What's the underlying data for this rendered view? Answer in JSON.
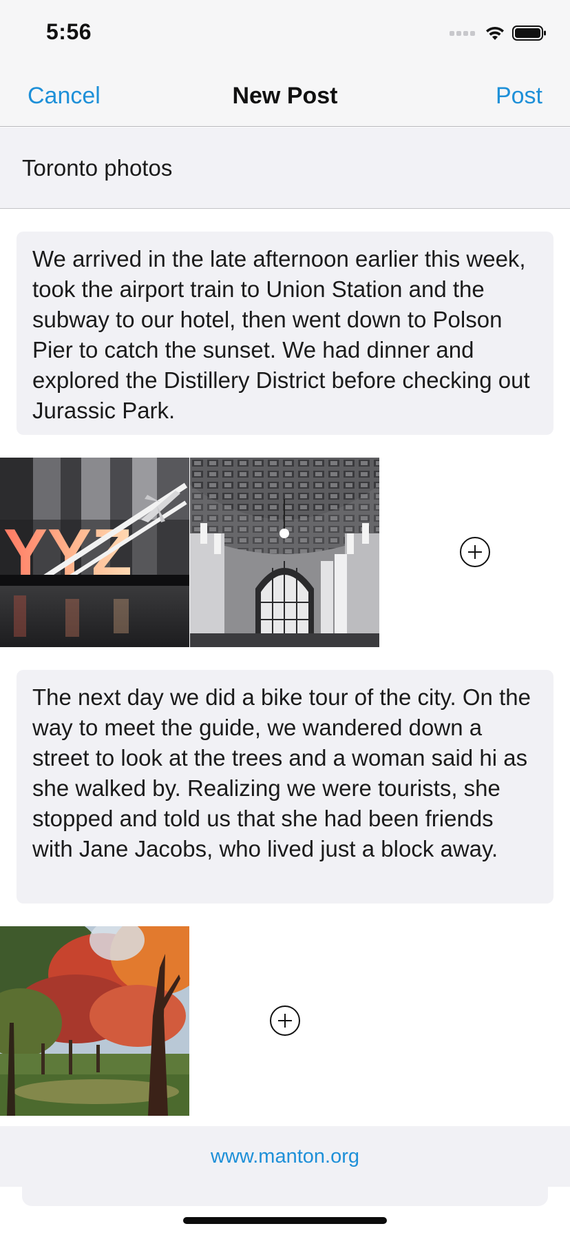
{
  "status_bar": {
    "time": "5:56"
  },
  "nav": {
    "cancel_label": "Cancel",
    "title": "New Post",
    "post_label": "Post"
  },
  "post": {
    "title": "Toronto photos",
    "paragraphs": [
      "We arrived in the late afternoon earlier this week, took the airport train to Union Station and the subway to our hotel, then went down to Polson Pier to catch the sunset. We had dinner and explored the Distillery District before checking out Jurassic Park.",
      "The next day we did a bike tour of the city. On the way to meet the guide, we wandered down a street to look at the trees and a woman said hi as she walked by. Realizing we were tourists, she stopped and told us that she had been friends with Jane Jacobs, who lived just a block away."
    ],
    "photo_rows": [
      {
        "photos": [
          "yyz-sign-photo",
          "union-station-photo"
        ],
        "add_icon": "plus-circle-icon"
      },
      {
        "photos": [
          "autumn-trees-photo"
        ],
        "add_icon": "plus-circle-icon"
      }
    ],
    "yyz_sign_text": "YYZ"
  },
  "footer": {
    "link": "www.manton.org"
  },
  "colors": {
    "accent": "#1e90d8",
    "block_bg": "#f1f1f5",
    "bar_bg": "#f6f6f7"
  },
  "icons": [
    "signal-icon",
    "wifi-icon",
    "battery-icon",
    "plus-circle-icon"
  ]
}
